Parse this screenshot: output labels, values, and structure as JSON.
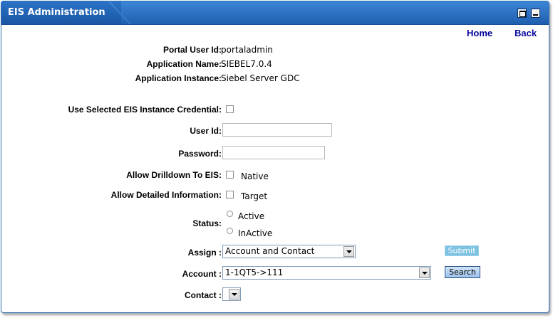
{
  "portlet": {
    "title": "EIS Administration"
  },
  "nav": {
    "home": "Home",
    "back": "Back"
  },
  "info": {
    "portal_user_id_label": "Portal User Id:",
    "portal_user_id_value": "portaladmin",
    "app_name_label": "Application Name:",
    "app_name_value": "SIEBEL7.0.4",
    "app_instance_label": "Application Instance:",
    "app_instance_value": "Siebel Server GDC"
  },
  "form": {
    "use_credential_label": "Use Selected EIS Instance Credential:",
    "user_id_label": "User Id:",
    "user_id_value": "",
    "password_label": "Password:",
    "password_value": "",
    "drilldown_label": "Allow Drilldown To EIS:",
    "native_label": "Native",
    "detailed_label": "Allow Detailed Information:",
    "target_label": "Target",
    "status_label": "Status:",
    "status_active": "Active",
    "status_inactive": "InActive",
    "assign_label": "Assign :",
    "assign_value": "Account and Contact",
    "account_label": "Account :",
    "account_value": "1-1QT5->111",
    "contact_label": "Contact :",
    "contact_value": ""
  },
  "buttons": {
    "submit": "Submit",
    "search": "Search"
  }
}
